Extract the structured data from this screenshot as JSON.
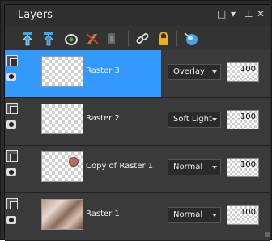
{
  "panel": {
    "title": "Layers",
    "controls": {
      "restore": "□",
      "menu": "▾",
      "pin": "⊥",
      "close": "✕"
    }
  },
  "toolbar": {
    "icons": [
      {
        "name": "new-raster-layer-icon",
        "color": "#3aa8e8"
      },
      {
        "name": "new-vector-layer-icon",
        "color": "#3aa8e8"
      },
      {
        "name": "new-mask-layer-icon",
        "color": "#e0e0e0"
      },
      {
        "name": "delete-layer-icon",
        "color": "#c08030"
      },
      {
        "name": "layer-properties-icon",
        "color": "#777777"
      },
      {
        "name": "link-layers-icon",
        "color": "#e0e0e0"
      },
      {
        "name": "lock-transparency-icon",
        "color": "#e8b020"
      },
      {
        "name": "edit-selection-icon",
        "color": "#4aa0e0"
      }
    ]
  },
  "layers": [
    {
      "name": "Raster 3",
      "blend_mode": "Overlay",
      "opacity": "100",
      "selected": true
    },
    {
      "name": "Raster 2",
      "blend_mode": "Soft Light",
      "opacity": "100",
      "selected": false
    },
    {
      "name": "Copy of Raster 1",
      "blend_mode": "Normal",
      "opacity": "100",
      "selected": false
    },
    {
      "name": "Raster 1",
      "blend_mode": "Normal",
      "opacity": "100",
      "selected": false
    }
  ],
  "colors": {
    "selection": "#3399ff",
    "panel_bg": "#333333"
  }
}
